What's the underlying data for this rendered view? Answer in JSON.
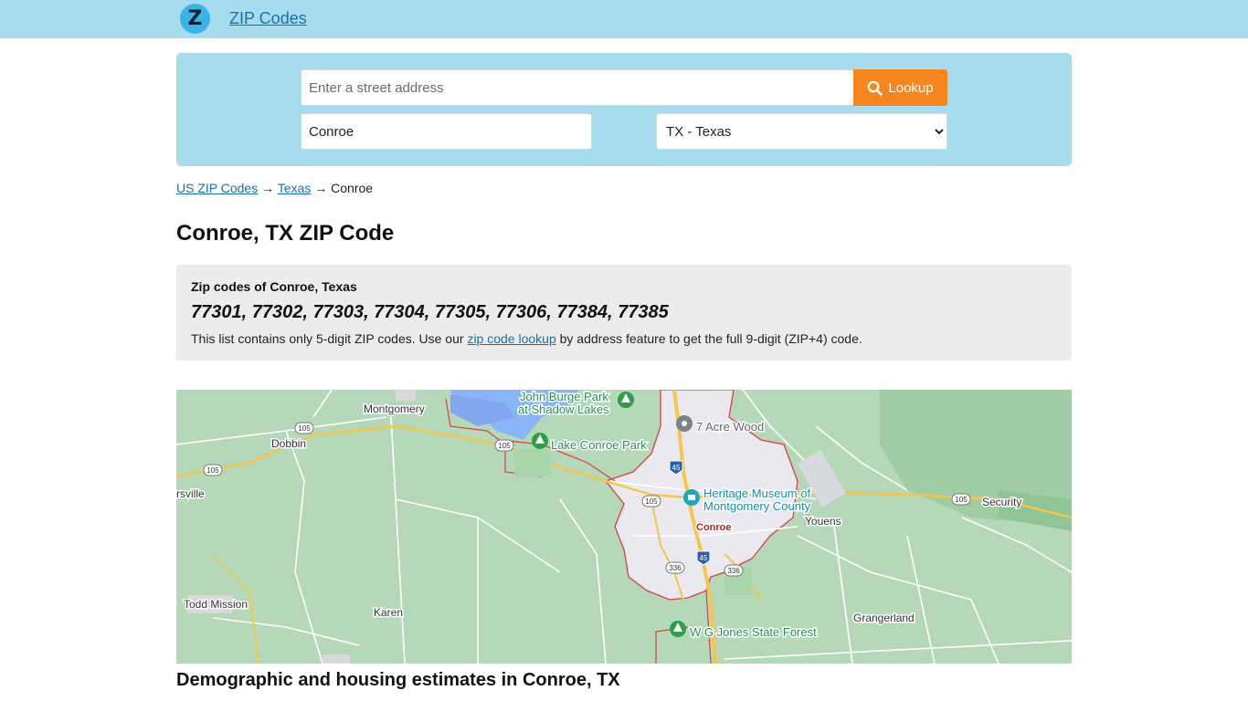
{
  "header": {
    "logo_letter": "Z",
    "site_name": "ZIP Codes"
  },
  "search": {
    "address_placeholder": "Enter a street address",
    "address_value": "",
    "lookup_label": "Lookup",
    "city_value": "Conroe",
    "state_selected": "TX - Texas"
  },
  "breadcrumb": {
    "root": "US ZIP Codes",
    "arrow": "→",
    "state": "Texas",
    "city": "Conroe"
  },
  "page_title": "Conroe, TX ZIP Code",
  "zip_box": {
    "label": "Zip codes of Conroe, Texas",
    "codes": "77301, 77302, 77303, 77304, 77305, 77306, 77384, 77385",
    "note_before": "This list contains only 5-digit ZIP codes. Use our ",
    "note_link": "zip code lookup",
    "note_after": " by address feature to get the full 9-digit (ZIP+4) code."
  },
  "map": {
    "labels": {
      "montgomery": "Montgomery",
      "dobbin": "Dobbin",
      "ersville": "rsville",
      "todd_mission": "Todd Mission",
      "karen": "Karen",
      "john_burge": "John Burge Park",
      "shadow_lakes": "at Shadow Lakes",
      "lake_conroe_park": "Lake Conroe Park",
      "acre_wood": "7 Acre Wood",
      "heritage1": "Heritage Museum of",
      "heritage2": "Montgomery County",
      "conroe": "Conroe",
      "youens": "Youens",
      "security": "Security",
      "grangerland": "Grangerland",
      "wg_jones": "W G Jones State Forest"
    },
    "shields": {
      "r105": "105",
      "r336": "336",
      "i45": "45"
    },
    "colors": {
      "land": "#b5d8b8",
      "forest": "#9fcca3",
      "city": "#e9e9ef",
      "boundary": "#d94040",
      "water": "#8ab4f8",
      "highway": "#f5c64a",
      "park_marker": "#2e9e48"
    }
  },
  "section_title": "Demographic and housing estimates in Conroe, TX"
}
